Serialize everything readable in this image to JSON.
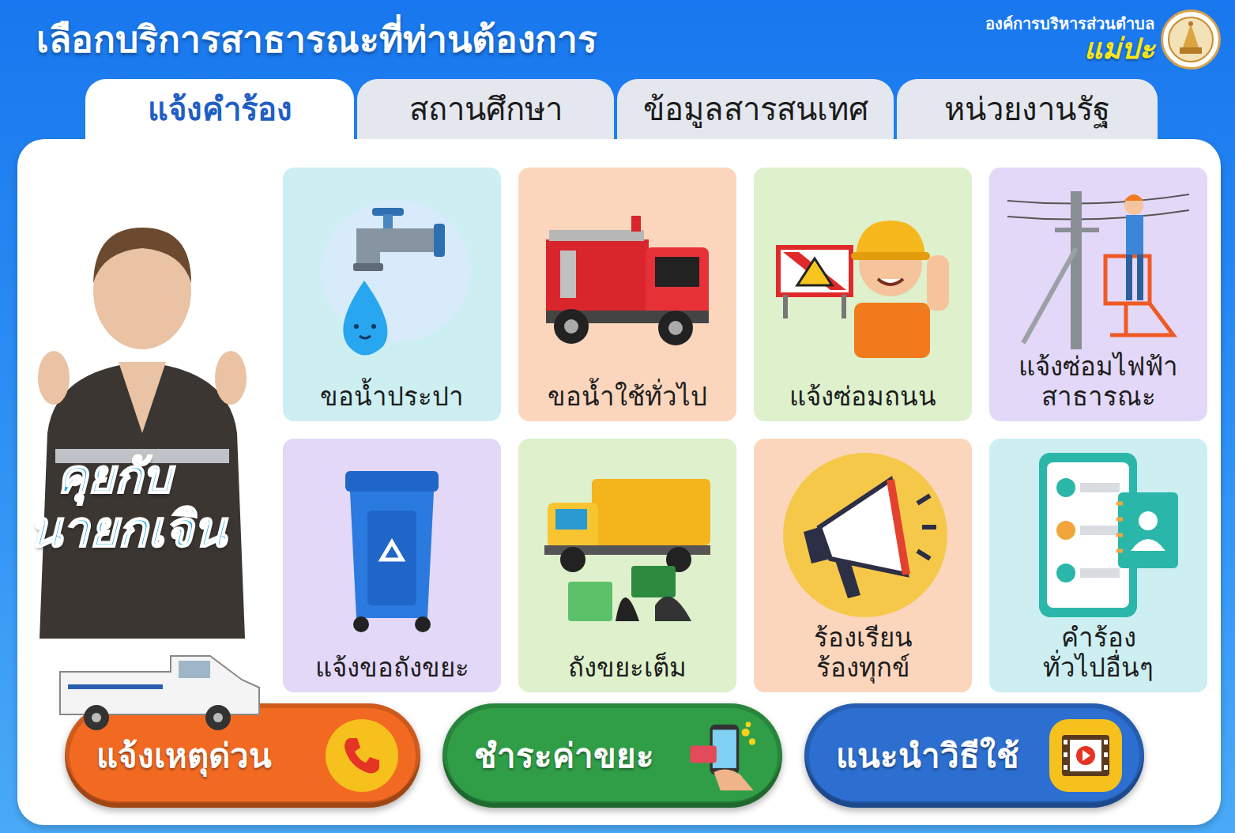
{
  "header": {
    "title": "เลือกบริการสาธารณะที่ท่านต้องการ",
    "org_top": "องค์การบริหารส่วนตำบล",
    "org_name": "แม่ปะ"
  },
  "tabs": [
    {
      "label": "แจ้งคำร้อง",
      "selected": true
    },
    {
      "label": "สถานศึกษา",
      "selected": false
    },
    {
      "label": "ข้อมูลสารสนเทศ",
      "selected": false
    },
    {
      "label": "หน่วยงานรัฐ",
      "selected": false
    }
  ],
  "promo": {
    "line1": "คุยกับ",
    "line2": "นายกเจิน"
  },
  "services": [
    {
      "label": [
        "ขอน้ำประปา"
      ],
      "color": "#cdeff2"
    },
    {
      "label": [
        "ขอน้ำใช้ทั่วไป"
      ],
      "color": "#fbd6bd"
    },
    {
      "label": [
        "แจ้งซ่อมถนน"
      ],
      "color": "#def0cc"
    },
    {
      "label": [
        "แจ้งซ่อมไฟฟ้า",
        "สาธารณะ"
      ],
      "color": "#e3d8f8"
    },
    {
      "label": [
        "แจ้งขอถังขยะ"
      ],
      "color": "#e3d8f8"
    },
    {
      "label": [
        "ถังขยะเต็ม"
      ],
      "color": "#def0cc"
    },
    {
      "label": [
        "ร้องเรียน",
        "ร้องทุกข์"
      ],
      "color": "#fbd6bd"
    },
    {
      "label": [
        "คำร้อง",
        "ทั่วไปอื่นๆ"
      ],
      "color": "#cdeff2"
    }
  ],
  "actions": [
    {
      "label": "แจ้งเหตุด่วน",
      "color": "#f26a22"
    },
    {
      "label": "ชำระค่าขยะ",
      "color": "#2f9e47"
    },
    {
      "label": "แนะนำวิธีใช้",
      "color": "#2c6fd1"
    }
  ]
}
